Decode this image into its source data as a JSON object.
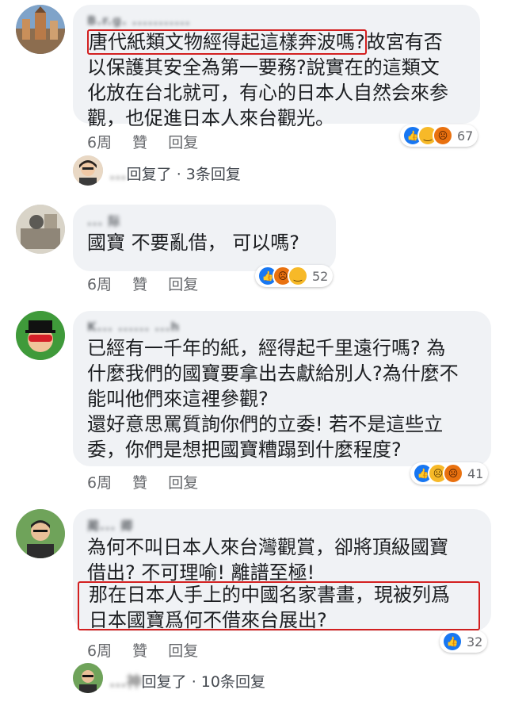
{
  "comments": [
    {
      "name": "B.r.g. ...........",
      "lines": [
        "唐代紙類文物經得起這樣奔波嗎?故宮有否",
        "以保護其安全為第一要務?說實在的這類文",
        "化放在台北就可，有心的日本人自然会來参",
        "觀，也促進日本人來台觀光。"
      ],
      "highlight": "唐代紙類文物經得起這樣奔波嗎?",
      "rest_first_line": "故宮有否",
      "age": "6周",
      "like": "贊",
      "reply": "回复",
      "reaction_count": "67"
    },
    {
      "name": "... 际",
      "lines": [
        "國寶 不要亂借，  可以嗎?"
      ],
      "age": "6周",
      "like": "贊",
      "reply": "回复",
      "reaction_count": "52"
    },
    {
      "name": "K... ...... ...h",
      "lines": [
        "已經有一千年的紙，經得起千里遠行嗎? 為",
        "什麼我們的國寶要拿出去獻給別人?為什麼不",
        "能叫他們來這裡參觀?",
        "還好意思罵質詢你們的立委! 若不是這些立",
        "委，你們是想把國寶糟蹋到什麼程度?"
      ],
      "age": "6周",
      "like": "贊",
      "reply": "回复",
      "reaction_count": "41"
    },
    {
      "name": "蔺... 卿",
      "lines": [
        "為何不叫日本人來台灣觀賞，卻將頂級國寶",
        "借出? 不可理喻! 離譜至極!"
      ],
      "highlight_lines": [
        "那在日本人手上的中國名家書畫，現被列爲",
        "日本國寶爲何不借來台展出?"
      ],
      "age": "6周",
      "like": "贊",
      "reply": "回复",
      "reaction_count": "32"
    }
  ],
  "replies": [
    {
      "name": "...",
      "text": "回复了 · 3条回复"
    },
    {
      "name": "...神",
      "text": "回复了 · 10条回复"
    }
  ]
}
